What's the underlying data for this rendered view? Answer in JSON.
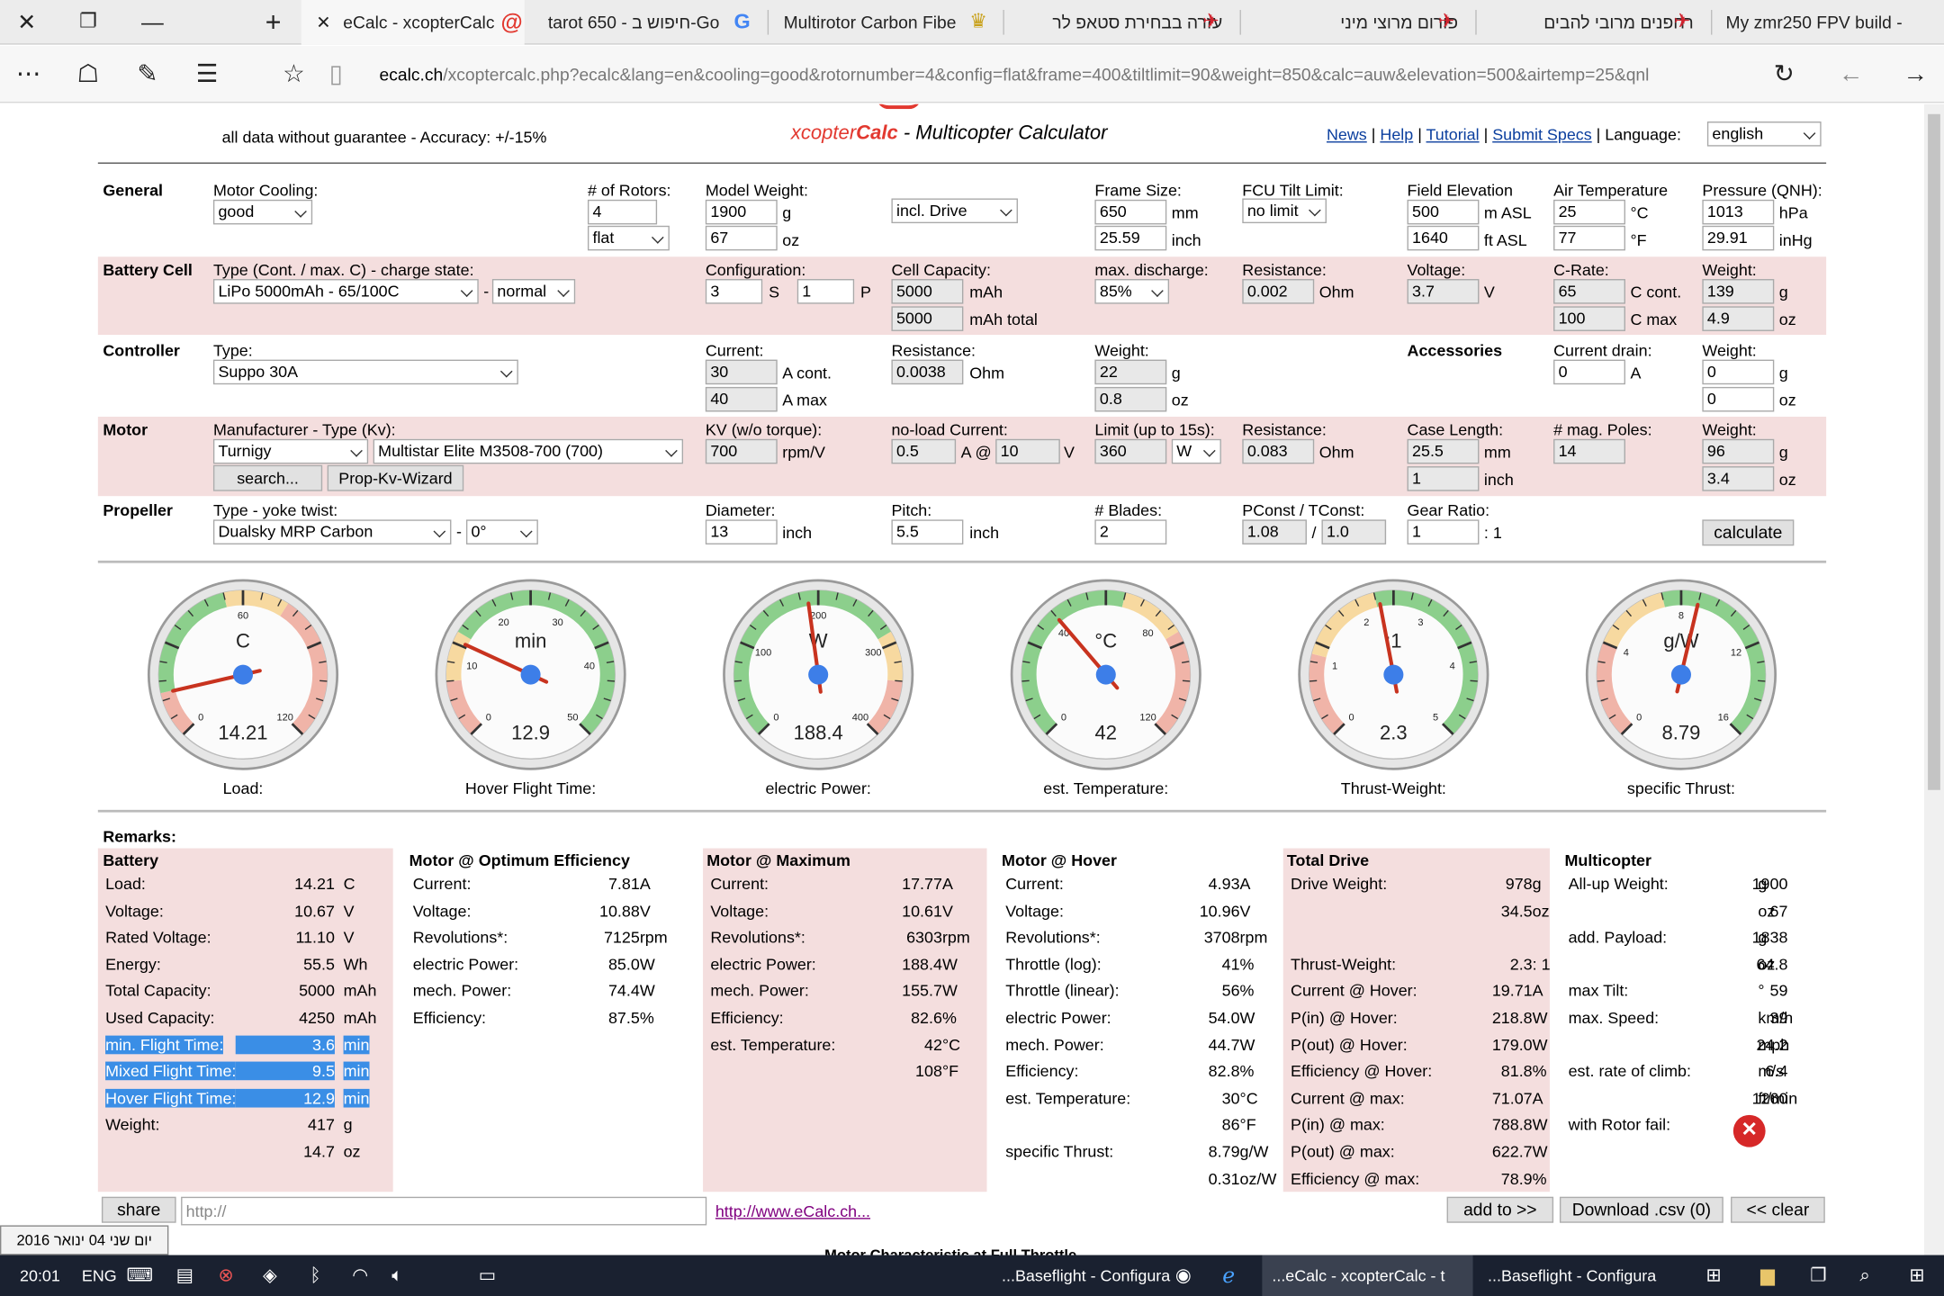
{
  "browser": {
    "tabs": [
      "eCalc - xcopterCalc",
      "tarot 650 - חיפוש ב-Go",
      "Multirotor Carbon Fibe",
      "עזרה בבחירת סטאפ לר",
      "פורום מרוצי מיני",
      "רחפנים מרובי להבים",
      "My zmr250 FPV build -"
    ],
    "url_host": "ecalc.ch",
    "url_path": "/xcoptercalc.php?ecalc&lang=en&cooling=good&rotornumber=4&config=flat&frame=400&tiltlimit=90&weight=850&calc=auw&elevation=500&airtemp=25&qnl"
  },
  "header": {
    "disclaimer": "all data without guarantee - Accuracy: +/-15%",
    "brand1": "xcopter",
    "brand2": "Calc",
    "title_rest": " - Multicopter Calculator",
    "links": [
      "News",
      "Help",
      "Tutorial",
      "Submit Specs"
    ],
    "language_label": "Language:",
    "language": "english"
  },
  "general": {
    "section": "General",
    "cooling_label": "Motor Cooling:",
    "cooling": "good",
    "rotors_label": "# of Rotors:",
    "rotors": "4",
    "config": "flat",
    "weight_label": "Model Weight:",
    "weight_g": "1900",
    "weight_g_unit": "g",
    "weight_oz": "67",
    "weight_oz_unit": "oz",
    "drive": "incl. Drive",
    "frame_label": "Frame Size:",
    "frame_mm": "650",
    "frame_mm_unit": "mm",
    "frame_in": "25.59",
    "frame_in_unit": "inch",
    "tilt_label": "FCU Tilt Limit:",
    "tilt": "no limit",
    "elev_label": "Field Elevation",
    "elev_m": "500",
    "elev_m_unit": "m ASL",
    "elev_ft": "1640",
    "elev_ft_unit": "ft ASL",
    "temp_label": "Air Temperature",
    "temp_c": "25",
    "temp_c_unit": "°C",
    "temp_f": "77",
    "temp_f_unit": "°F",
    "press_label": "Pressure (QNH):",
    "press_hpa": "1013",
    "press_hpa_unit": "hPa",
    "press_inhg": "29.91",
    "press_inhg_unit": "inHg"
  },
  "battery": {
    "section": "Battery Cell",
    "type_label": "Type (Cont. / max. C) - charge state:",
    "type": "LiPo 5000mAh - 65/100C",
    "dash": "-",
    "state": "normal",
    "config_label": "Configuration:",
    "s": "3",
    "s_unit": "S",
    "p": "1",
    "p_unit": "P",
    "cap_label": "Cell Capacity:",
    "cap": "5000",
    "cap_unit": "mAh",
    "cap_total": "5000",
    "cap_total_unit": "mAh total",
    "disch_label": "max. discharge:",
    "disch": "85%",
    "res_label": "Resistance:",
    "res": "0.002",
    "res_unit": "Ohm",
    "volt_label": "Voltage:",
    "volt": "3.7",
    "volt_unit": "V",
    "crate_label": "C-Rate:",
    "c_cont": "65",
    "c_cont_unit": "C cont.",
    "c_max": "100",
    "c_max_unit": "C max",
    "weight_label": "Weight:",
    "w_g": "139",
    "w_g_unit": "g",
    "w_oz": "4.9",
    "w_oz_unit": "oz"
  },
  "controller": {
    "section": "Controller",
    "type_label": "Type:",
    "type": "Suppo 30A",
    "cur_label": "Current:",
    "cur_cont": "30",
    "cur_cont_unit": "A cont.",
    "cur_max": "40",
    "cur_max_unit": "A max",
    "res_label": "Resistance:",
    "res": "0.0038",
    "res_unit": "Ohm",
    "weight_label": "Weight:",
    "w_g": "22",
    "w_g_unit": "g",
    "w_oz": "0.8",
    "w_oz_unit": "oz",
    "acc_section": "Accessories",
    "drain_label": "Current drain:",
    "drain": "0",
    "drain_unit": "A",
    "acc_w_label": "Weight:",
    "acc_w_g": "0",
    "acc_w_g_unit": "g",
    "acc_w_oz": "0",
    "acc_w_oz_unit": "oz"
  },
  "motor": {
    "section": "Motor",
    "mfr_label": "Manufacturer - Type (Kv):",
    "mfr": "Turnigy",
    "model": "Multistar Elite M3508-700 (700)",
    "search": "search...",
    "wizard": "Prop-Kv-Wizard",
    "kv_label": "KV (w/o torque):",
    "kv": "700",
    "kv_unit": "rpm/V",
    "nl_label": "no-load Current:",
    "nl_a": "0.5",
    "nl_a_unit": "A @",
    "nl_v": "10",
    "nl_v_unit": "V",
    "limit_label": "Limit (up to 15s):",
    "limit": "360",
    "limit_unit": "W",
    "res_label": "Resistance:",
    "res": "0.083",
    "res_unit": "Ohm",
    "case_label": "Case Length:",
    "case_mm": "25.5",
    "case_mm_unit": "mm",
    "case_in": "1",
    "case_in_unit": "inch",
    "poles_label": "# mag. Poles:",
    "poles": "14",
    "weight_label": "Weight:",
    "w_g": "96",
    "w_g_unit": "g",
    "w_oz": "3.4",
    "w_oz_unit": "oz"
  },
  "propeller": {
    "section": "Propeller",
    "type_label": "Type - yoke twist:",
    "type": "Dualsky MRP Carbon",
    "dash": "-",
    "twist": "0°",
    "dia_label": "Diameter:",
    "dia": "13",
    "dia_unit": "inch",
    "pitch_label": "Pitch:",
    "pitch": "5.5",
    "pitch_unit": "inch",
    "blades_label": "# Blades:",
    "blades": "2",
    "pconst_label": "PConst / TConst:",
    "pconst": "1.08",
    "slash": "/",
    "tconst": "1.0",
    "gear_label": "Gear Ratio:",
    "gear": "1",
    "gear_unit": ": 1",
    "calc": "calculate"
  },
  "gauges": [
    {
      "unit": "C",
      "value": "14.21",
      "label": "Load:",
      "num": 14.21,
      "min": 0,
      "max": 120,
      "ticks": [
        "0",
        "60",
        "120"
      ]
    },
    {
      "unit": "min",
      "value": "12.9",
      "label": "Hover Flight Time:",
      "num": 12.9,
      "min": 0,
      "max": 50,
      "ticks": [
        "0",
        "10",
        "20",
        "30",
        "40",
        "50"
      ]
    },
    {
      "unit": "W",
      "value": "188.4",
      "label": "electric Power:",
      "num": 188.4,
      "min": 0,
      "max": 400,
      "ticks": [
        "0",
        "100",
        "200",
        "300",
        "400"
      ]
    },
    {
      "unit": "°C",
      "value": "42",
      "label": "est. Temperature:",
      "num": 42,
      "min": 0,
      "max": 120,
      "ticks": [
        "0",
        "40",
        "80",
        "120"
      ]
    },
    {
      "unit": ":1",
      "value": "2.3",
      "label": "Thrust-Weight:",
      "num": 2.3,
      "min": 0,
      "max": 5,
      "ticks": [
        "0",
        "1",
        "2",
        "3",
        "4",
        "5"
      ]
    },
    {
      "unit": "g/W",
      "value": "8.79",
      "label": "specific Thrust:",
      "num": 8.79,
      "min": 0,
      "max": 16,
      "ticks": [
        "0",
        "4",
        "8",
        "12",
        "16"
      ]
    }
  ],
  "remarks": {
    "title": "Remarks:",
    "battery": {
      "head": "Battery",
      "rows": [
        [
          "Load:",
          "14.21",
          "C"
        ],
        [
          "Voltage:",
          "10.67",
          "V"
        ],
        [
          "Rated Voltage:",
          "11.10",
          "V"
        ],
        [
          "Energy:",
          "55.5",
          "Wh"
        ],
        [
          "Total Capacity:",
          "5000",
          "mAh"
        ],
        [
          "Used Capacity:",
          "4250",
          "mAh"
        ],
        [
          "min. Flight Time:",
          "3.6",
          "min"
        ],
        [
          "Mixed Flight Time:",
          "9.5",
          "min"
        ],
        [
          "Hover Flight Time:",
          "12.9",
          "min"
        ],
        [
          "Weight:",
          "417",
          "g"
        ],
        [
          "",
          "14.7",
          "oz"
        ]
      ]
    },
    "opt": {
      "head": "Motor @ Optimum Efficiency",
      "rows": [
        [
          "Current:",
          "7.81",
          "A"
        ],
        [
          "Voltage:",
          "10.88",
          "V"
        ],
        [
          "Revolutions*:",
          "7125",
          "rpm"
        ],
        [
          "electric Power:",
          "85.0",
          "W"
        ],
        [
          "mech. Power:",
          "74.4",
          "W"
        ],
        [
          "Efficiency:",
          "87.5",
          "%"
        ]
      ]
    },
    "max": {
      "head": "Motor @ Maximum",
      "rows": [
        [
          "Current:",
          "17.77",
          "A"
        ],
        [
          "Voltage:",
          "10.61",
          "V"
        ],
        [
          "Revolutions*:",
          "6303",
          "rpm"
        ],
        [
          "electric Power:",
          "188.4",
          "W"
        ],
        [
          "mech. Power:",
          "155.7",
          "W"
        ],
        [
          "Efficiency:",
          "82.6",
          "%"
        ],
        [
          "est. Temperature:",
          "42",
          "°C"
        ],
        [
          "",
          "108",
          "°F"
        ]
      ]
    },
    "hover": {
      "head": "Motor @ Hover",
      "rows": [
        [
          "Current:",
          "4.93",
          "A"
        ],
        [
          "Voltage:",
          "10.96",
          "V"
        ],
        [
          "Revolutions*:",
          "3708",
          "rpm"
        ],
        [
          "Throttle (log):",
          "41",
          "%"
        ],
        [
          "Throttle (linear):",
          "56",
          "%"
        ],
        [
          "electric Power:",
          "54.0",
          "W"
        ],
        [
          "mech. Power:",
          "44.7",
          "W"
        ],
        [
          "Efficiency:",
          "82.8",
          "%"
        ],
        [
          "est. Temperature:",
          "30",
          "°C"
        ],
        [
          "",
          "86",
          "°F"
        ],
        [
          "specific Thrust:",
          "8.79",
          "g/W"
        ],
        [
          "",
          "0.31",
          "oz/W"
        ]
      ]
    },
    "drive": {
      "head": "Total Drive",
      "rows": [
        [
          "Drive Weight:",
          "978",
          "g"
        ],
        [
          "",
          "34.5",
          "oz"
        ],
        [
          "Thrust-Weight:",
          "2.3",
          ": 1"
        ],
        [
          "Current @ Hover:",
          "19.71",
          "A"
        ],
        [
          "P(in) @ Hover:",
          "218.8",
          "W"
        ],
        [
          "P(out) @ Hover:",
          "179.0",
          "W"
        ],
        [
          "Efficiency @ Hover:",
          "81.8",
          "%"
        ],
        [
          "Current @ max:",
          "71.07",
          "A"
        ],
        [
          "P(in) @ max:",
          "788.8",
          "W"
        ],
        [
          "P(out) @ max:",
          "622.7",
          "W"
        ],
        [
          "Efficiency @ max:",
          "78.9",
          "%"
        ]
      ]
    },
    "multi": {
      "head": "Multicopter",
      "rows": [
        [
          "All-up Weight:",
          "1900",
          "g"
        ],
        [
          "",
          "67",
          "oz"
        ],
        [
          "add. Payload:",
          "1838",
          "g"
        ],
        [
          "",
          "64.8",
          "oz"
        ],
        [
          "max Tilt:",
          "59",
          "°"
        ],
        [
          "max. Speed:",
          "39",
          "km/h"
        ],
        [
          "",
          "24.2",
          "mph"
        ],
        [
          "est. rate of climb:",
          "6.4",
          "m/s"
        ],
        [
          "",
          "1260",
          "ft/min"
        ],
        [
          "with Rotor fail:",
          "",
          ""
        ]
      ]
    }
  },
  "footer": {
    "share": "share",
    "share_placeholder": "http://",
    "link": "http://www.eCalc.ch...",
    "add": "add to >>",
    "download": "Download .csv (0)",
    "clear": "<< clear",
    "next_heading": "Motor Characteristic at Full Throttle"
  },
  "taskbar": {
    "time": "20:01",
    "lang": "ENG",
    "date_tip": "יום שני 04 ינואר 2016",
    "apps": [
      "...Baseflight - Configura",
      "...eCalc - xcopterCalc - t",
      "...Baseflight - Configura"
    ]
  }
}
